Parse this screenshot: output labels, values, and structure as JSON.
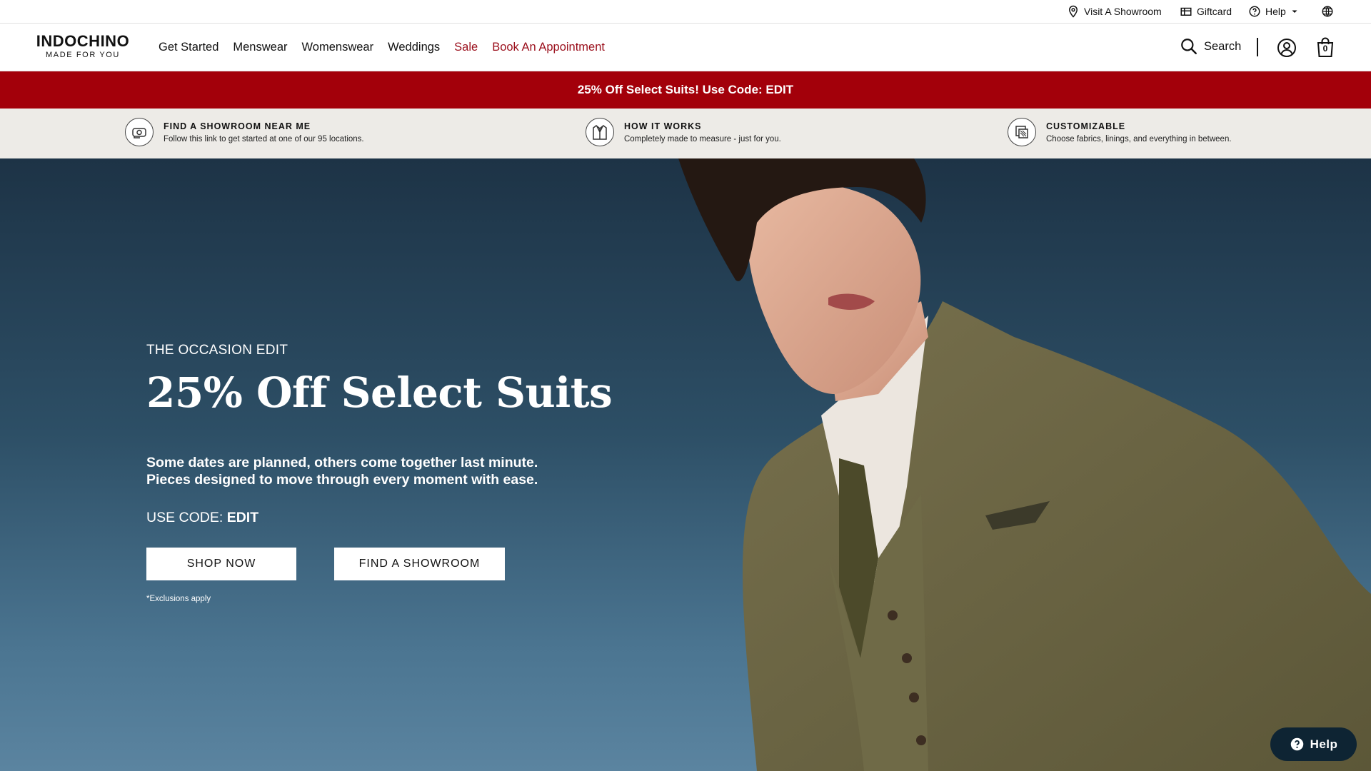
{
  "utility": {
    "showroom": "Visit A Showroom",
    "giftcard": "Giftcard",
    "help": "Help"
  },
  "header": {
    "logo_word": "INDOCHINO",
    "logo_tagline": "MADE FOR YOU",
    "nav": [
      {
        "label": "Get Started"
      },
      {
        "label": "Menswear"
      },
      {
        "label": "Womenswear"
      },
      {
        "label": "Weddings"
      },
      {
        "label": "Sale"
      },
      {
        "label": "Book An Appointment"
      }
    ],
    "search_label": "Search",
    "bag_count": "0"
  },
  "promo_banner": {
    "text": "25% Off Select Suits! Use Code: EDIT"
  },
  "features": [
    {
      "title": "FIND A SHOWROOM NEAR ME",
      "desc": "Follow this link to get started at one of our 95 locations.",
      "icon": "measuring-tape-icon"
    },
    {
      "title": "HOW IT WORKS",
      "desc": "Completely made to measure - just for you.",
      "icon": "jacket-icon"
    },
    {
      "title": "CUSTOMIZABLE",
      "desc": "Choose fabrics, linings, and everything in between.",
      "icon": "fabric-swatch-icon"
    }
  ],
  "hero": {
    "eyebrow": "THE OCCASION EDIT",
    "headline": "25% Off Select Suits",
    "subcopy_1": "Some dates are planned, others come together last minute.",
    "subcopy_2": "Pieces designed to move through every moment with ease.",
    "code_prefix": "USE CODE: ",
    "code": "EDIT",
    "cta_shop": "SHOP NOW",
    "cta_showroom": "FIND A SHOWROOM",
    "fineprint": "*Exclusions apply"
  },
  "help_fab": {
    "label": "Help"
  },
  "colors": {
    "promo_red": "#a3000a",
    "sale_red": "#9a0d1a",
    "features_bg": "#edebe7",
    "help_navy": "#0e2433"
  }
}
